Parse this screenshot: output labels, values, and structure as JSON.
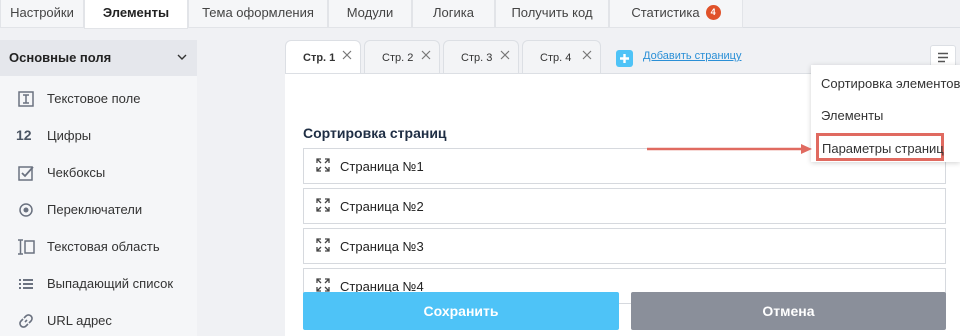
{
  "top_tabs": [
    {
      "label": "Настройки"
    },
    {
      "label": "Элементы"
    },
    {
      "label": "Тема оформления"
    },
    {
      "label": "Модули"
    },
    {
      "label": "Логика"
    },
    {
      "label": "Получить код"
    },
    {
      "label": "Статистика",
      "badge": "4"
    }
  ],
  "active_top_tab": "Элементы",
  "sidebar": {
    "title": "Основные поля",
    "items": [
      {
        "label": "Текстовое поле",
        "icon": "text-field-icon"
      },
      {
        "label": "Цифры",
        "icon": "numbers-icon",
        "glyph": "12"
      },
      {
        "label": "Чекбоксы",
        "icon": "checkbox-icon"
      },
      {
        "label": "Переключатели",
        "icon": "radio-icon"
      },
      {
        "label": "Текстовая область",
        "icon": "textarea-icon"
      },
      {
        "label": "Выпадающий список",
        "icon": "dropdown-list-icon"
      },
      {
        "label": "URL адрес",
        "icon": "link-icon"
      }
    ]
  },
  "page_tabs": [
    {
      "label": "Стр. 1"
    },
    {
      "label": "Стр. 2"
    },
    {
      "label": "Стр. 3"
    },
    {
      "label": "Стр. 4"
    }
  ],
  "active_page_tab": "Стр. 1",
  "add_page_label": "Добавить страницу",
  "section_title": "Сортировка страниц",
  "pages": [
    "Страница №1",
    "Страница №2",
    "Страница №3",
    "Страница №4"
  ],
  "buttons": {
    "save": "Сохранить",
    "cancel": "Отмена"
  },
  "dropdown": {
    "items": [
      "Сортировка элементов",
      "Элементы",
      "Параметры страниц"
    ],
    "highlighted": "Параметры страниц"
  },
  "colors": {
    "accent": "#4ec3f7",
    "cancel": "#8a8f9a",
    "badge": "#e0522a",
    "highlight": "#e06a60",
    "link": "#2a8fd6"
  }
}
